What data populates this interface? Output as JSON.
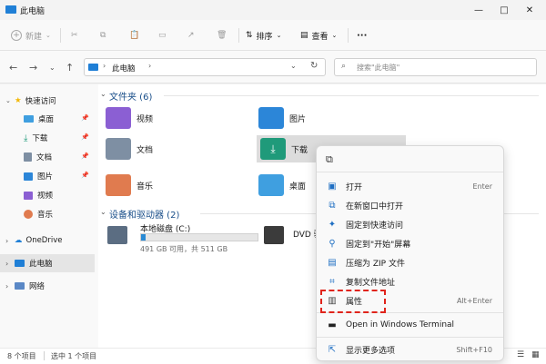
{
  "window": {
    "title": "此电脑",
    "minimize_glyph": "—",
    "maximize_glyph": "□",
    "close_glyph": "✕"
  },
  "toolbar": {
    "new_label": "新建",
    "sort_label": "排序",
    "view_label": "查看",
    "more_label": "···"
  },
  "address": {
    "path": "此电脑",
    "search_placeholder": "搜索\"此电脑\""
  },
  "sidebar": {
    "quick_access": "快速访问",
    "items": [
      {
        "label": "桌面"
      },
      {
        "label": "下载"
      },
      {
        "label": "文档"
      },
      {
        "label": "图片"
      },
      {
        "label": "视频"
      },
      {
        "label": "音乐"
      }
    ],
    "onedrive": "OneDrive",
    "this_pc": "此电脑",
    "network": "网络"
  },
  "main": {
    "folders_header": "文件夹 (6)",
    "folders": [
      {
        "label": "视频",
        "color": "#8b5fd3"
      },
      {
        "label": "图片",
        "color": "#2c86d8"
      },
      {
        "label": "文档",
        "color": "#7e8fa3"
      },
      {
        "label": "下载",
        "color": "#1f9a7a"
      },
      {
        "label": "音乐",
        "color": "#e07b4f"
      },
      {
        "label": "桌面",
        "color": "#3f9fe0"
      }
    ],
    "drives_header": "设备和驱动器 (2)",
    "drive_c": {
      "label": "本地磁盘 (C:)",
      "space": "491 GB 可用，共 511 GB",
      "used_fraction": 0.04
    },
    "drive_dvd": {
      "label": "DVD 驱"
    }
  },
  "status": {
    "count": "8 个项目",
    "selected": "选中 1 个项目"
  },
  "context_menu": {
    "items": [
      {
        "label": "打开",
        "shortcut": "Enter",
        "icon": "open-icon"
      },
      {
        "label": "在新窗口中打开",
        "shortcut": "",
        "icon": "new-window-icon"
      },
      {
        "label": "固定到快速访问",
        "shortcut": "",
        "icon": "pin-icon"
      },
      {
        "label": "固定到\"开始\"屏幕",
        "shortcut": "",
        "icon": "pin-start-icon"
      },
      {
        "label": "压缩为 ZIP 文件",
        "shortcut": "",
        "icon": "zip-icon"
      },
      {
        "label": "复制文件地址",
        "shortcut": "",
        "icon": "copy-path-icon"
      },
      {
        "label": "属性",
        "shortcut": "Alt+Enter",
        "icon": "properties-icon"
      },
      {
        "label": "Open in Windows Terminal",
        "shortcut": "",
        "icon": "terminal-icon"
      },
      {
        "label": "显示更多选项",
        "shortcut": "Shift+F10",
        "icon": "more-options-icon"
      }
    ]
  }
}
